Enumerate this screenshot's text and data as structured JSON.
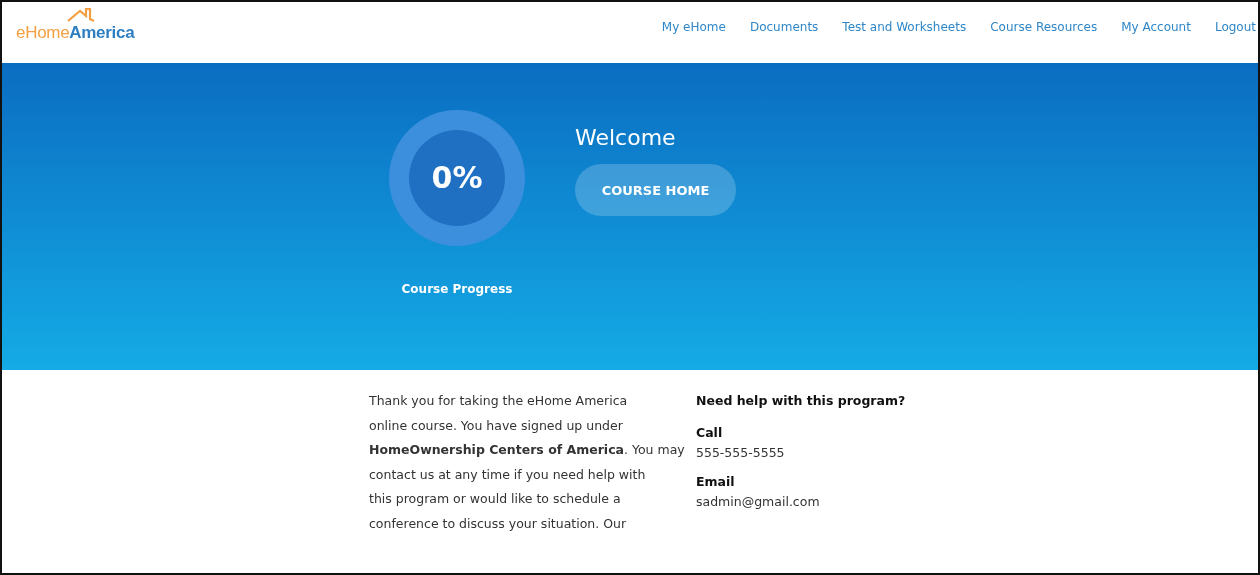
{
  "logo": {
    "part_1": "eHome",
    "part_2": "America"
  },
  "nav": [
    {
      "label": "My eHome"
    },
    {
      "label": "Documents"
    },
    {
      "label": "Test and Worksheets"
    },
    {
      "label": "Course Resources"
    },
    {
      "label": "My Account"
    },
    {
      "label": "Logout"
    }
  ],
  "hero": {
    "progress": {
      "value": "0%",
      "label": "Course Progress"
    },
    "title": "Welcome",
    "button": "COURSE HOME"
  },
  "intro": {
    "lines": [
      "Thank you for taking the eHome America",
      "online course. You have signed up under",
      "**HomeOwnership Centers of America**. You may",
      "contact us at any time if you need help with",
      "this program or would like to schedule a",
      "conference to discuss your situation. Our"
    ]
  },
  "help": {
    "heading": "Need help with this program?",
    "contacts": [
      {
        "label": "Call",
        "value": "555-555-5555"
      },
      {
        "label": "Email",
        "value": "sadmin@gmail.com"
      }
    ]
  }
}
